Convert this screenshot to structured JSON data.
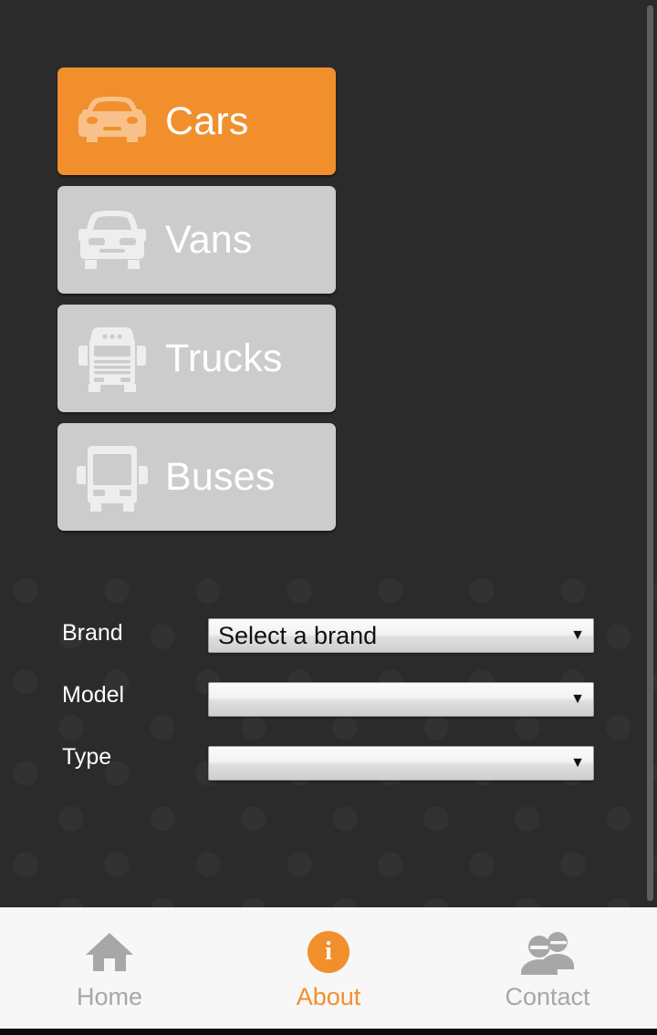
{
  "app": {
    "background_color": "#2b2b2b",
    "accent_color": "#f18f2c",
    "inactive_color": "#cccccc"
  },
  "categories": [
    {
      "id": "cars",
      "label": "Cars",
      "icon": "car-icon",
      "active": true
    },
    {
      "id": "vans",
      "label": "Vans",
      "icon": "van-icon",
      "active": false
    },
    {
      "id": "trucks",
      "label": "Trucks",
      "icon": "truck-icon",
      "active": false
    },
    {
      "id": "buses",
      "label": "Buses",
      "icon": "bus-icon",
      "active": false
    }
  ],
  "form": {
    "rows": [
      {
        "id": "brand",
        "label": "Brand",
        "value": "Select a brand",
        "arrow": "▼"
      },
      {
        "id": "model",
        "label": "Model",
        "value": "",
        "arrow": "▼"
      },
      {
        "id": "type",
        "label": "Type",
        "value": "",
        "arrow": "▼"
      }
    ]
  },
  "bottom_nav": {
    "items": [
      {
        "id": "home",
        "label": "Home",
        "icon": "home-icon",
        "active": false
      },
      {
        "id": "about",
        "label": "About",
        "icon": "info-icon",
        "active": true,
        "glyph": "i"
      },
      {
        "id": "contact",
        "label": "Contact",
        "icon": "people-icon",
        "active": false
      }
    ]
  }
}
